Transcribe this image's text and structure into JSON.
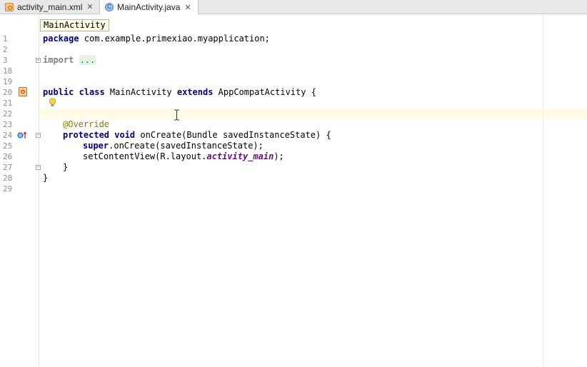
{
  "tabs": [
    {
      "label": "activity_main.xml",
      "icon": "xml-layout-icon",
      "active": false,
      "close": "✕"
    },
    {
      "label": "MainActivity.java",
      "icon": "java-class-icon",
      "active": true,
      "close": "✕",
      "icon_letter": "C"
    }
  ],
  "breadcrumb": "MainActivity",
  "lines": {
    "l1": {
      "num": "1",
      "kw": "package",
      "text": " com.example.primexiao.myapplication;"
    },
    "l2": {
      "num": "2"
    },
    "l3": {
      "num": "3",
      "kw": "import",
      "fold": "..."
    },
    "l18": {
      "num": "18"
    },
    "l19": {
      "num": "19"
    },
    "l20": {
      "num": "20",
      "kw1": "public class",
      "name": " MainActivity ",
      "kw2": "extends",
      "text": " AppCompatActivity {"
    },
    "l21": {
      "num": "21"
    },
    "l22": {
      "num": "22"
    },
    "l23": {
      "num": "23",
      "annotation": "@Override"
    },
    "l24": {
      "num": "24",
      "kw": "protected void",
      "text": " onCreate(Bundle savedInstanceState) {"
    },
    "l25": {
      "num": "25",
      "kw": "super",
      "text": ".onCreate(savedInstanceState);"
    },
    "l26": {
      "num": "26",
      "pre": "setContentView(R.layout.",
      "field": "activity_main",
      "post": ");"
    },
    "l27": {
      "num": "27",
      "text": "}"
    },
    "l28": {
      "num": "28",
      "text": "}"
    },
    "l29": {
      "num": "29"
    }
  },
  "colors": {
    "keyword": "#000080",
    "annotation": "#808000",
    "field": "#660e7a",
    "caret_row": "#fefbe6"
  }
}
